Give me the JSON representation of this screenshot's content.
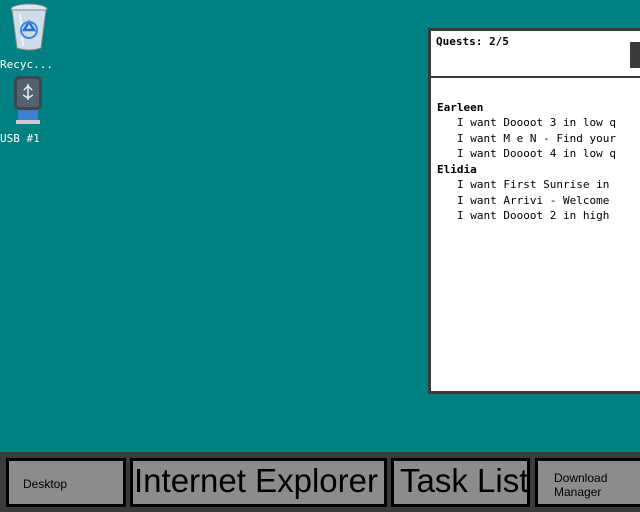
{
  "desktop": {
    "icons": [
      {
        "label": "Recyc...",
        "icon": "recycle-bin-icon"
      },
      {
        "label": "USB #1",
        "icon": "usb-drive-icon"
      }
    ]
  },
  "quest_window": {
    "count": "Quests: 2/5",
    "groups": [
      {
        "person": "Earleen",
        "items": [
          "I want Doooot 3 in low q",
          "I want M e N - Find your",
          "I want Doooot 4 in low q"
        ]
      },
      {
        "person": "Elidia",
        "items": [
          "I want First Sunrise in",
          "I want Arrivi - Welcome",
          "I want Doooot 2 in high"
        ]
      }
    ]
  },
  "taskbar": {
    "buttons": [
      {
        "label": "Desktop"
      },
      {
        "label": "Internet Explorer"
      },
      {
        "label": "Task List"
      },
      {
        "label": "Download Manager"
      }
    ]
  }
}
